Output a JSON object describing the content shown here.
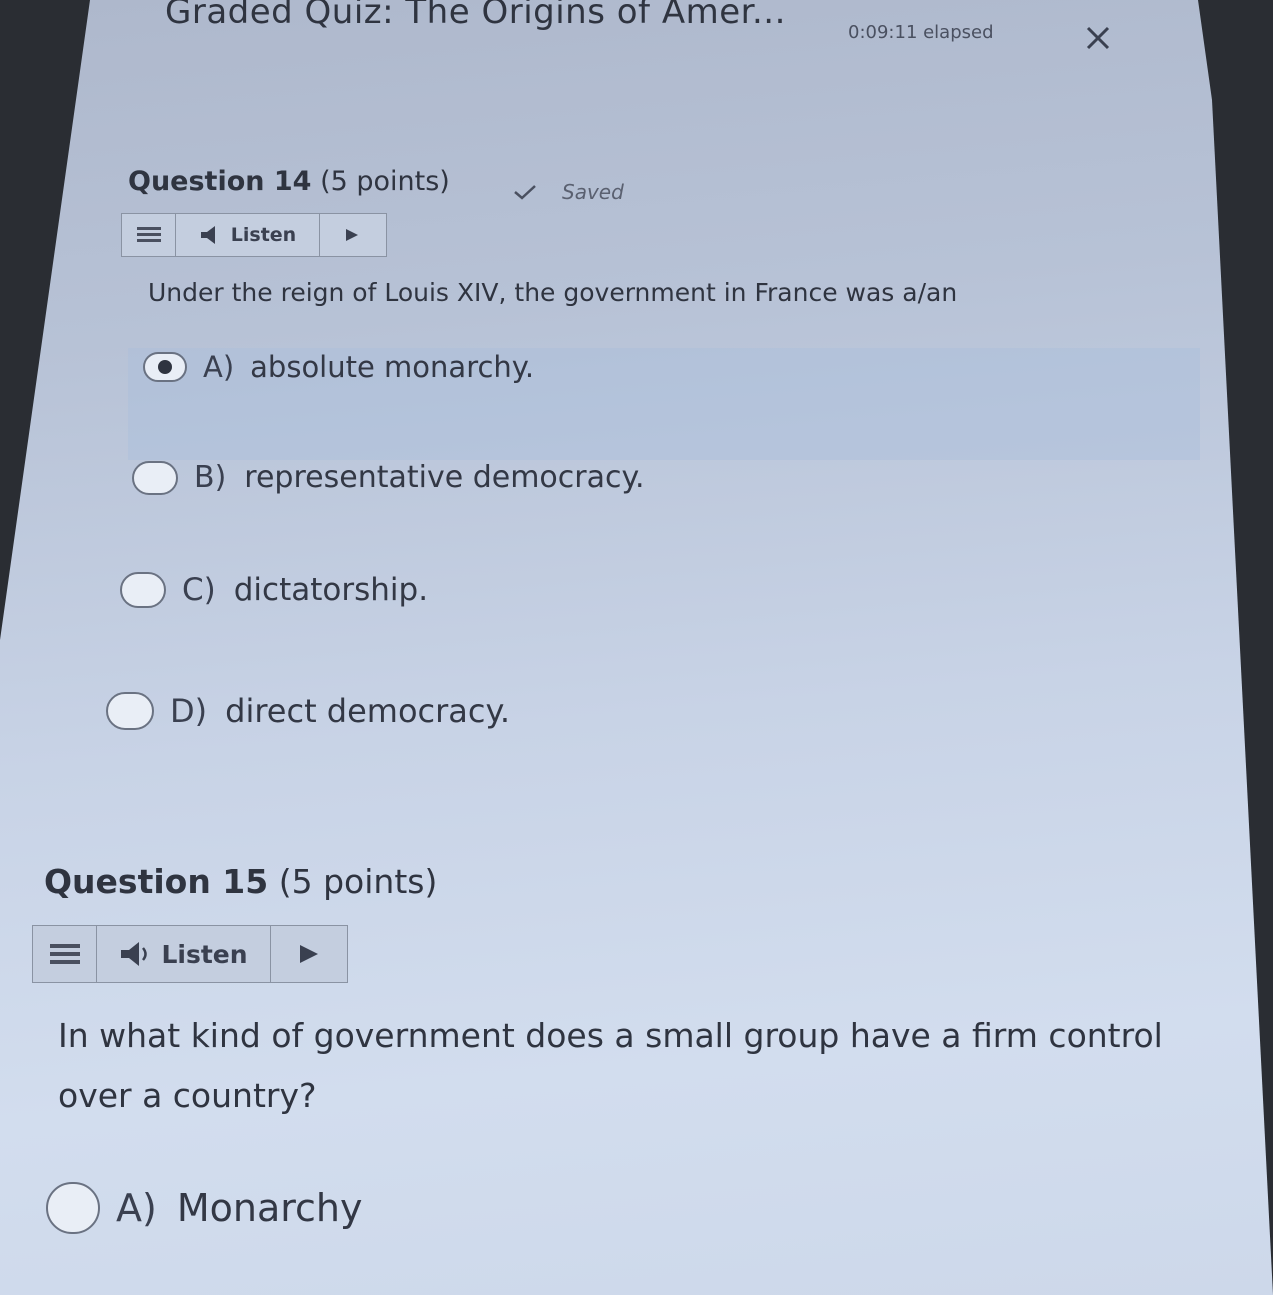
{
  "quiz": {
    "title": "Graded Quiz: The Origins of Amer...",
    "elapsed": "0:09:11 elapsed",
    "close_icon": "close-icon"
  },
  "questions": [
    {
      "number_label": "Question 14",
      "points_label": "(5 points)",
      "status": "Saved",
      "listen_label": "Listen",
      "text": "Under the reign of Louis XIV, the government in France was a/an",
      "options": [
        {
          "letter": "A)",
          "text": "absolute monarchy.",
          "selected": true
        },
        {
          "letter": "B)",
          "text": "representative democracy.",
          "selected": false
        },
        {
          "letter": "C)",
          "text": "dictatorship.",
          "selected": false
        },
        {
          "letter": "D)",
          "text": "direct democracy.",
          "selected": false
        }
      ]
    },
    {
      "number_label": "Question 15",
      "points_label": "(5 points)",
      "listen_label": "Listen",
      "text": "In what kind of government does a small group have a firm control over a country?",
      "options": [
        {
          "letter": "A)",
          "text": "Monarchy",
          "selected": false
        }
      ]
    }
  ],
  "colors": {
    "selected_highlight": "#aabedc",
    "text": "#2f3440"
  }
}
